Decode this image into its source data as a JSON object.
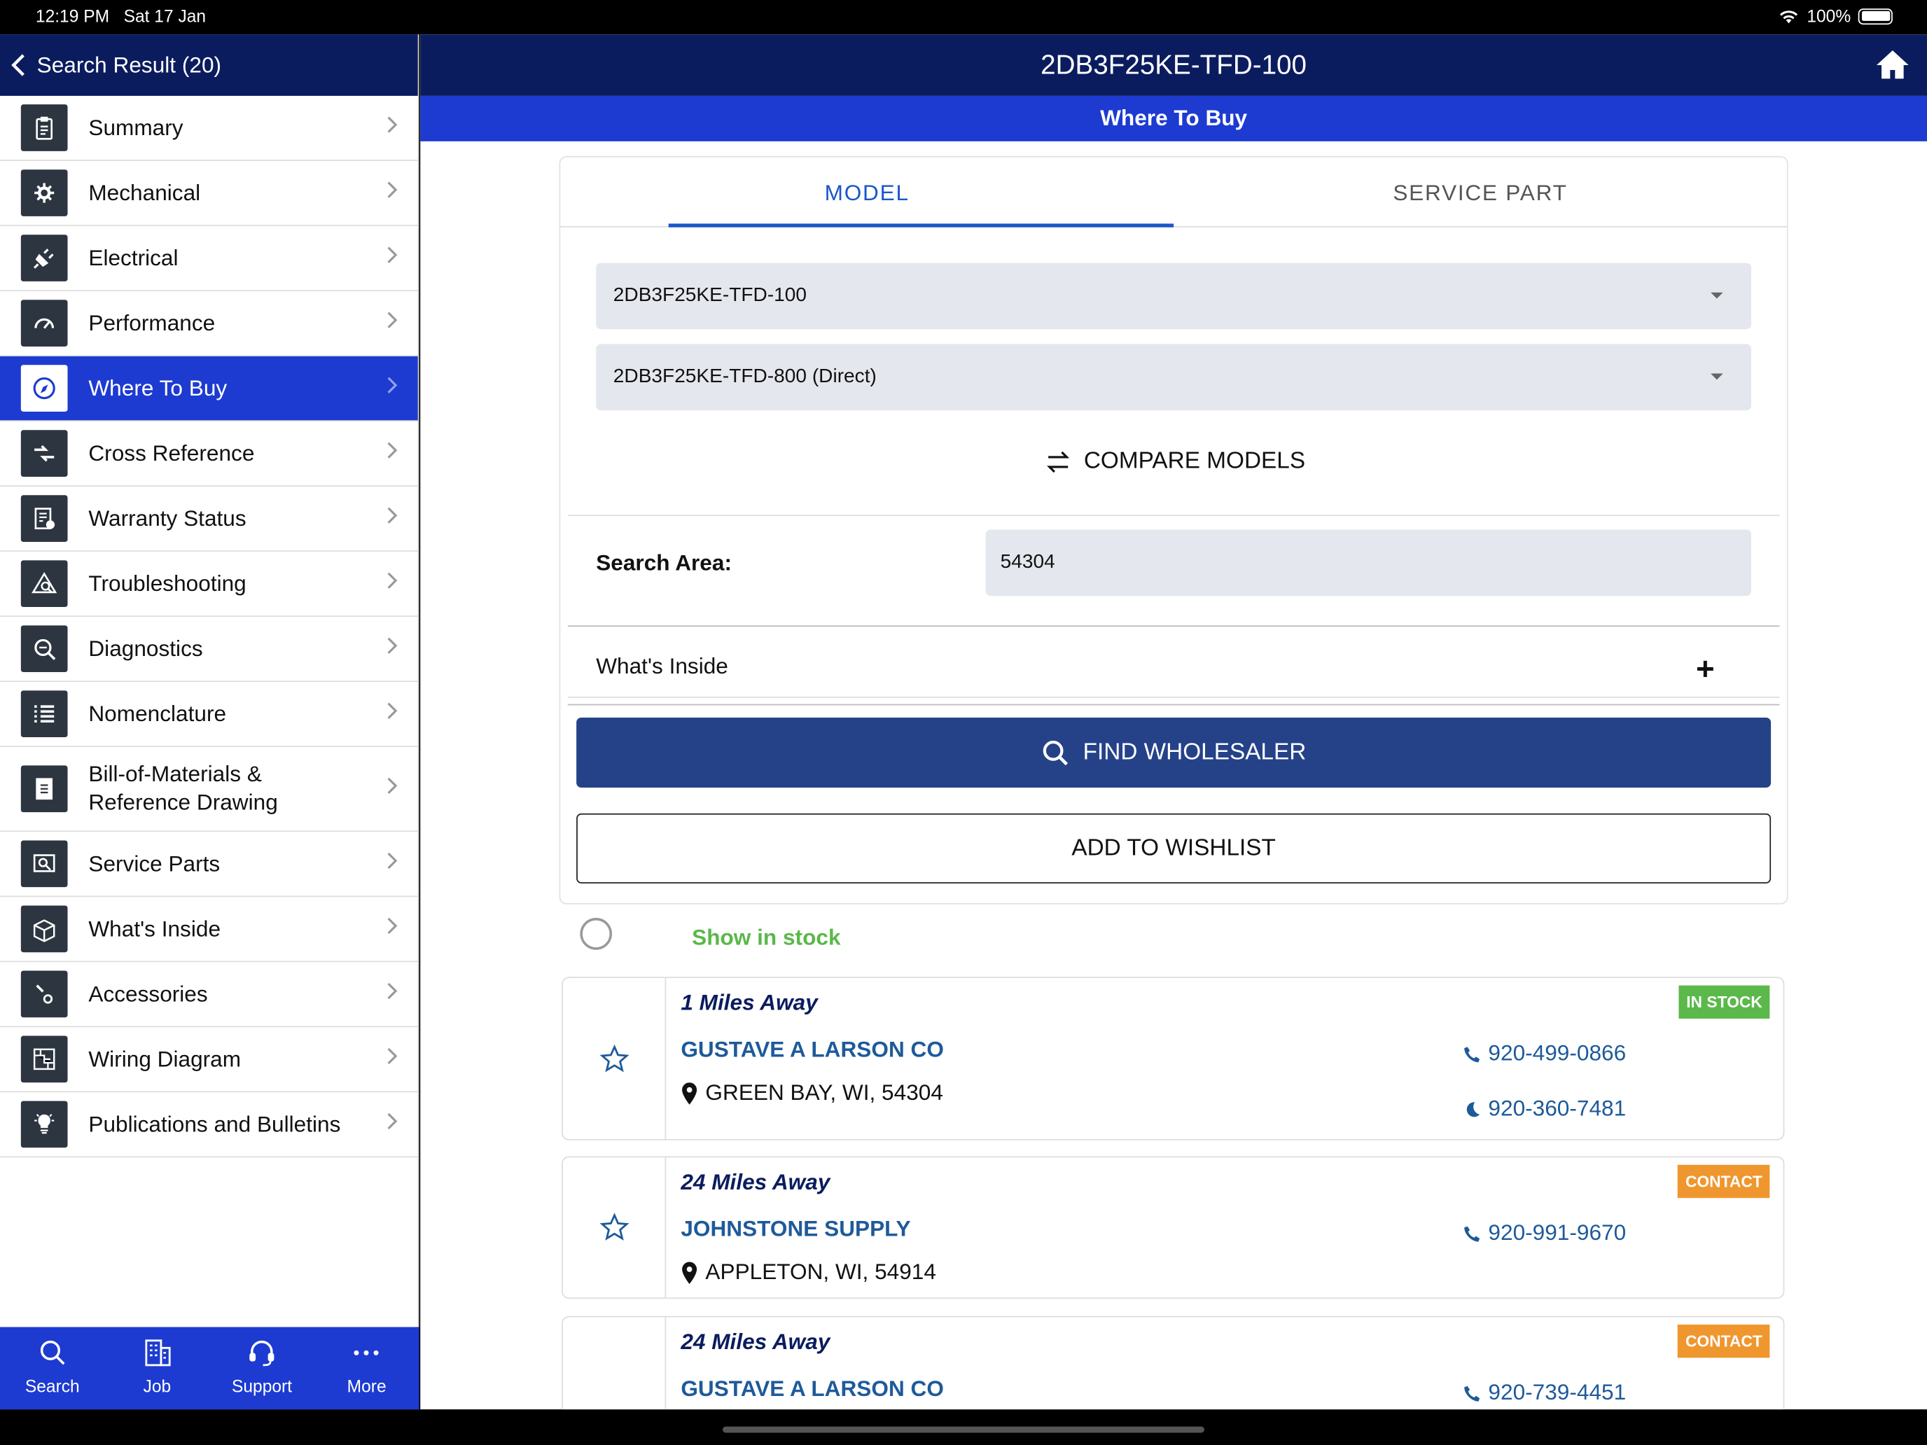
{
  "status": {
    "time": "12:19 PM",
    "date": "Sat 17 Jan",
    "battery": "100%"
  },
  "sidebar": {
    "back_label": "Search Result (20)",
    "items": [
      {
        "label": "Summary",
        "icon": "clipboard-icon"
      },
      {
        "label": "Mechanical",
        "icon": "gear-wrench-icon"
      },
      {
        "label": "Electrical",
        "icon": "plug-icon"
      },
      {
        "label": "Performance",
        "icon": "gauge-icon"
      },
      {
        "label": "Where To Buy",
        "icon": "compass-icon"
      },
      {
        "label": "Cross Reference",
        "icon": "arrows-icon"
      },
      {
        "label": "Warranty Status",
        "icon": "document-check-icon"
      },
      {
        "label": "Troubleshooting",
        "icon": "warning-search-icon"
      },
      {
        "label": "Diagnostics",
        "icon": "magnifier-icon"
      },
      {
        "label": "Nomenclature",
        "icon": "list-icon"
      },
      {
        "label": "Bill-of-Materials &",
        "label2": "Reference Drawing",
        "icon": "drawing-icon"
      },
      {
        "label": "Service Parts",
        "icon": "parts-icon"
      },
      {
        "label": "What's Inside",
        "icon": "box-icon"
      },
      {
        "label": "Accessories",
        "icon": "tools-icon"
      },
      {
        "label": "Wiring Diagram",
        "icon": "circuit-icon"
      },
      {
        "label": "Publications and Bulletins",
        "icon": "lightbulb-icon"
      }
    ]
  },
  "bottom_tabs": [
    {
      "label": "Search",
      "icon": "search-icon"
    },
    {
      "label": "Job",
      "icon": "building-icon"
    },
    {
      "label": "Support",
      "icon": "headset-icon"
    },
    {
      "label": "More",
      "icon": "more-icon"
    }
  ],
  "header": {
    "title": "2DB3F25KE-TFD-100",
    "subtitle": "Where To Buy"
  },
  "tabs": {
    "model": "MODEL",
    "service_part": "SERVICE PART"
  },
  "form": {
    "model_select": "2DB3F25KE-TFD-100",
    "model_select_2": "2DB3F25KE-TFD-800 (Direct)",
    "compare": "COMPARE MODELS",
    "search_area_label": "Search Area:",
    "search_area_value": "54304",
    "whats_inside": "What's Inside",
    "plus": "+",
    "find": "FIND WHOLESALER",
    "wishlist": "ADD TO WISHLIST",
    "show_in_stock": "Show in stock"
  },
  "results": [
    {
      "distance": "1 Miles Away",
      "name": "GUSTAVE A LARSON CO",
      "address": "GREEN BAY, WI, 54304",
      "badge": "IN STOCK",
      "badge_color": "#5bb84a",
      "phone": "920-499-0866",
      "phone2": "920-360-7481"
    },
    {
      "distance": "24 Miles Away",
      "name": "JOHNSTONE SUPPLY",
      "address": "APPLETON, WI, 54914",
      "badge": "CONTACT",
      "badge_color": "#f0962e",
      "phone": "920-991-9670"
    },
    {
      "distance": "24 Miles Away",
      "name": "GUSTAVE A LARSON CO",
      "badge": "CONTACT",
      "badge_color": "#f0962e",
      "phone": "920-739-4451"
    }
  ],
  "colors": {
    "navy": "#0b1c5e",
    "primary": "#1d3bd1",
    "button": "#254289",
    "link": "#1e5a9a"
  }
}
